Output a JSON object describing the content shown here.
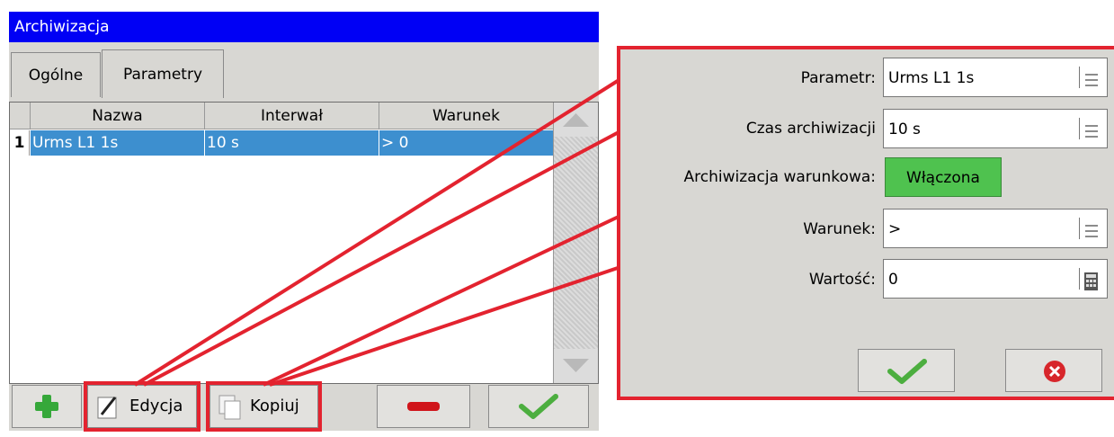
{
  "window": {
    "title": "Archiwizacja"
  },
  "tabs": [
    {
      "label": "Ogólne"
    },
    {
      "label": "Parametry"
    }
  ],
  "table": {
    "columns": [
      "Nazwa",
      "Interwał",
      "Warunek"
    ],
    "rows": [
      {
        "num": "1",
        "nazwa": "Urms L1 1s",
        "interwal": "10 s",
        "warunek": "> 0"
      }
    ]
  },
  "toolbar": {
    "add_icon": "plus-icon",
    "edit_label": "Edycja",
    "copy_label": "Kopiuj",
    "remove_icon": "minus-icon",
    "ok_icon": "check-icon"
  },
  "dialog": {
    "parametr_label": "Parametr:",
    "parametr_value": "Urms L1 1s",
    "czas_label": "Czas archiwizacji",
    "czas_value": "10 s",
    "arch_war_label": "Archiwizacja warunkowa:",
    "arch_war_value": "Włączona",
    "warunek_label": "Warunek:",
    "warunek_value": ">",
    "wartosc_label": "Wartość:",
    "wartosc_value": "0",
    "ok_icon": "check-icon",
    "cancel_icon": "cancel-icon"
  },
  "colors": {
    "titlebar": "#0000f5",
    "selection": "#3d8fcf",
    "highlight": "#e3232f",
    "toggle_on": "#4fc24f"
  }
}
